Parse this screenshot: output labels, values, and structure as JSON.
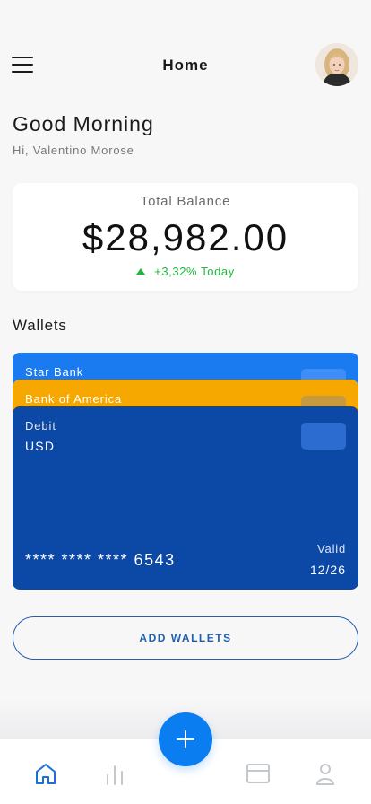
{
  "header": {
    "title": "Home",
    "menu_icon": "hamburger-menu-icon",
    "avatar": "user-avatar"
  },
  "greeting": {
    "title": "Good Morning",
    "subtitle": "Hi, Valentino Morose"
  },
  "balance": {
    "label": "Total Balance",
    "value": "$28,982.00",
    "change": "+3,32% Today",
    "change_icon": "triangle-up-icon",
    "change_color": "#1fb83e"
  },
  "wallets": {
    "title": "Wallets",
    "cards": [
      {
        "name": "Star Bank",
        "color": "#1a7af0"
      },
      {
        "name": "Bank of America",
        "color": "#f6a800"
      },
      {
        "name": "Debit",
        "currency": "USD",
        "number": "**** **** **** 6543",
        "valid_label": "Valid",
        "valid_date": "12/26",
        "color": "#0c48a6"
      }
    ],
    "add_label": "ADD WALLETS"
  },
  "tabbar": {
    "items": [
      {
        "name": "home",
        "icon": "home-icon",
        "active": true
      },
      {
        "name": "stats",
        "icon": "bar-chart-icon",
        "active": false
      },
      {
        "name": "cards",
        "icon": "credit-card-icon",
        "active": false
      },
      {
        "name": "profile",
        "icon": "user-icon",
        "active": false
      }
    ],
    "fab_icon": "plus-icon"
  },
  "colors": {
    "accent": "#0a7df0",
    "active_tab": "#1a6fd9",
    "inactive_tab": "#c4c7cc"
  }
}
